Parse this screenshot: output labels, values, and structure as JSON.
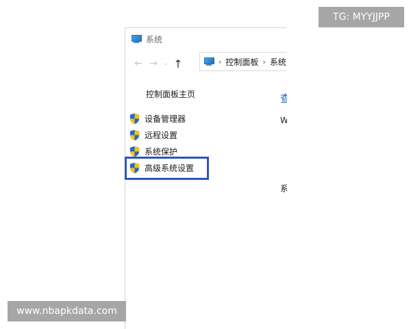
{
  "window": {
    "title": "系统",
    "title_icon": "computer-icon"
  },
  "nav": {
    "back_glyph": "←",
    "forward_glyph": "→",
    "recent_glyph": "⌄",
    "up_glyph": "↑"
  },
  "address_bar": {
    "icon": "computer-icon",
    "separator": "›",
    "crumbs": [
      "控制面板",
      "系统"
    ]
  },
  "sidebar": {
    "home_label": "控制面板主页",
    "items": [
      {
        "label": "设备管理器",
        "icon": "shield-icon"
      },
      {
        "label": "远程设置",
        "icon": "shield-icon"
      },
      {
        "label": "系统保护",
        "icon": "shield-icon"
      },
      {
        "label": "高级系统设置",
        "icon": "shield-icon"
      }
    ]
  },
  "content": {
    "heading_fragment": "查",
    "line_fragment": "W",
    "system_fragment": "系"
  },
  "watermarks": {
    "top_right": "TG: MYYJJPP",
    "bottom_left": "www.nbapkdata.com"
  },
  "colors": {
    "highlight_border": "#2e52c4",
    "heading_link": "#1a66b8",
    "watermark_bg": "#a6a6a6"
  }
}
